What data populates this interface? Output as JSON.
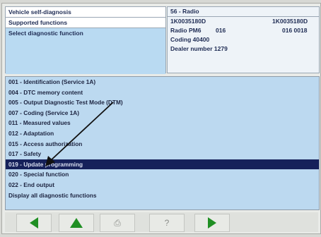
{
  "nav": {
    "items": [
      "Vehicle self-diagnosis",
      "Supported functions",
      "Select diagnostic function"
    ]
  },
  "info": {
    "header": "56 - Radio",
    "part_left": "1K0035180D",
    "part_right": "1K0035180D",
    "radio_label": "Radio PM6",
    "radio_code": "016",
    "radio_code_right": "016 0018",
    "coding": "Coding 40400",
    "dealer": "Dealer number 1279"
  },
  "functions": [
    "001 - Identification (Service 1A)",
    "004 - DTC memory content",
    "005 - Output Diagnostic Test Mode (DTM)",
    "007 - Coding (Service 1A)",
    "011 - Measured values",
    "012 - Adaptation",
    "015 - Access authorization",
    "017 - Safety",
    "019 - Update programming",
    "020 - Special function",
    "022 - End output",
    "Display all diagnostic functions"
  ],
  "selected_function_index": 8,
  "toolbar": {
    "back_icon": "arrow-left-icon",
    "up_icon": "arrow-up-icon",
    "print_icon": "printer-icon",
    "help_label": "?",
    "forward_icon": "arrow-right-icon"
  },
  "colors": {
    "nav_selected_bg": "#b9daf2",
    "list_bg": "#bcd9f0",
    "selected_row_bg": "#16215a",
    "toolbar_arrow": "#1f8f23"
  }
}
